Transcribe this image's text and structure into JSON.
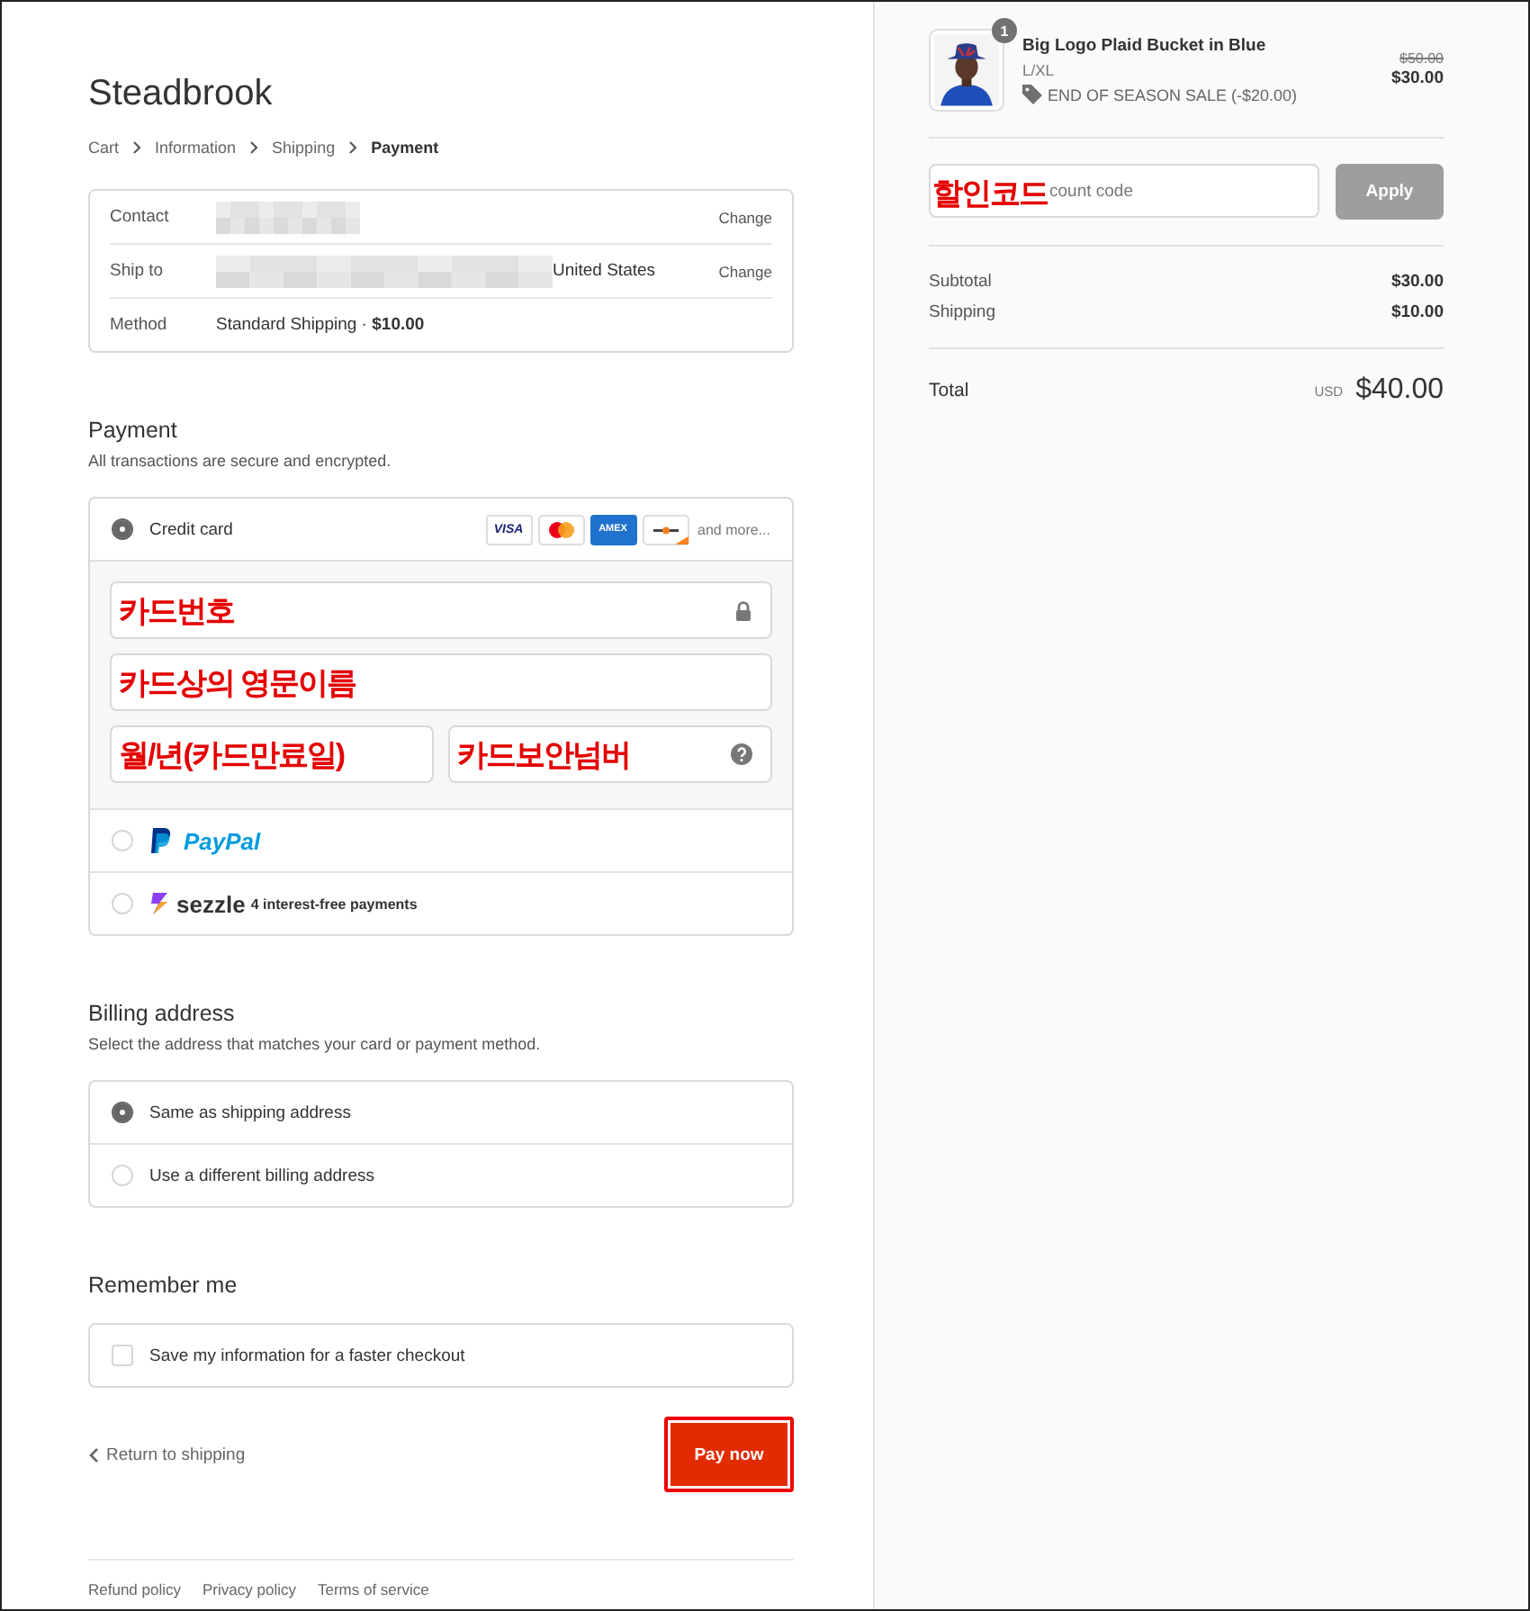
{
  "store": {
    "name": "Steadbrook"
  },
  "breadcrumb": [
    {
      "label": "Cart",
      "selected": false
    },
    {
      "label": "Information",
      "selected": false
    },
    {
      "label": "Shipping",
      "selected": false
    },
    {
      "label": "Payment",
      "selected": true
    }
  ],
  "review": [
    {
      "label": "Contact",
      "kind": "blurred",
      "action": "Change"
    },
    {
      "label": "Ship to",
      "kind": "blurred",
      "value": "United States",
      "action": "Change"
    },
    {
      "label": "Method",
      "kind": "text",
      "value": "Standard Shipping · **$10.00**"
    }
  ],
  "payment": {
    "title": "Payment",
    "subtitle": "All transactions are secure and encrypted.",
    "methods": [
      {
        "kind": "card",
        "label": "Credit card",
        "selected": true,
        "more": "and more...",
        "brands": [
          {
            "kind": "visa",
            "label": "VISA"
          },
          {
            "kind": "mastercard"
          },
          {
            "kind": "amex",
            "label": "AMEX"
          },
          {
            "kind": "discover"
          }
        ],
        "fields": [
          {
            "kind": "number",
            "annotation": "카드번호"
          },
          {
            "kind": "name",
            "annotation": "카드상의 영문이름"
          },
          {
            "kind": "expiry",
            "annotation": "월/년(카드만료일)"
          },
          {
            "kind": "security",
            "annotation": "카드보안넘버"
          }
        ]
      },
      {
        "kind": "paypal",
        "label": "PayPal",
        "selected": false
      },
      {
        "kind": "sezzle",
        "label": "sezzle",
        "note": "4 interest-free payments",
        "selected": false
      }
    ]
  },
  "billing": {
    "title": "Billing address",
    "subtitle": "Select the address that matches your card or payment method.",
    "options": [
      {
        "label": "Same as shipping address",
        "selected": true
      },
      {
        "label": "Use a different billing address",
        "selected": false
      }
    ]
  },
  "remember": {
    "title": "Remember me",
    "label": "Save my information for a faster checkout",
    "checked": false
  },
  "actions": {
    "back": "Return to shipping",
    "pay": "Pay now",
    "pay_highlighted": true
  },
  "footer": [
    "Refund policy",
    "Privacy policy",
    "Terms of service"
  ],
  "summary": {
    "product": {
      "quantity": "1",
      "name": "Big Logo Plaid Bucket in Blue",
      "variant": "L/XL",
      "discount": "END OF SEASON SALE (-$20.00)",
      "original_price": "$50.00",
      "price": "$30.00"
    },
    "discount": {
      "annotation": "할인코드",
      "placeholder": "count code",
      "button": "Apply",
      "disabled": true
    },
    "lines": [
      {
        "label": "Subtotal",
        "value": "$30.00"
      },
      {
        "label": "Shipping",
        "value": "$10.00"
      }
    ],
    "total": {
      "label": "Total",
      "currency": "USD",
      "amount": "$40.00"
    }
  }
}
